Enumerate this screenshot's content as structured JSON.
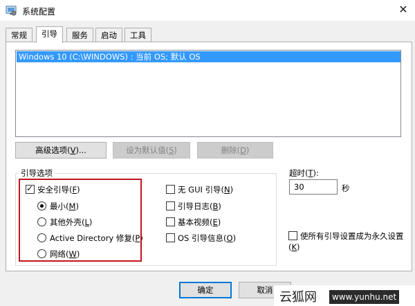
{
  "window": {
    "title": "系统配置"
  },
  "tabs": [
    {
      "label": "常规"
    },
    {
      "label": "引导",
      "active": true
    },
    {
      "label": "服务"
    },
    {
      "label": "启动"
    },
    {
      "label": "工具"
    }
  ],
  "os_list": {
    "items": [
      "Windows 10 (C:\\WINDOWS) : 当前 OS; 默认 OS"
    ]
  },
  "os_buttons": {
    "advanced": "高级选项(V)...",
    "set_default": "设为默认值(S)",
    "delete": "删除(D)"
  },
  "boot_options": {
    "legend": "引导选项",
    "safe_boot": {
      "label": "安全引导(F)",
      "checked": true
    },
    "radios": [
      {
        "label": "最小(M)",
        "checked": true
      },
      {
        "label": "其他外壳(L)",
        "checked": false
      },
      {
        "label": "Active Directory 修复(P)",
        "checked": false
      },
      {
        "label": "网络(W)",
        "checked": false
      }
    ],
    "checkboxes": [
      {
        "label": "无 GUI 引导(N)",
        "checked": false
      },
      {
        "label": "引导日志(B)",
        "checked": false
      },
      {
        "label": "基本视频(E)",
        "checked": false
      },
      {
        "label": "OS 引导信息(O)",
        "checked": false
      }
    ]
  },
  "timeout": {
    "label": "超时(T):",
    "value": "30",
    "unit": "秒"
  },
  "permanent": {
    "label": "使所有引导设置成为永久设置(K)",
    "checked": false
  },
  "footer": {
    "ok": "确定",
    "cancel": "取消"
  },
  "watermark": {
    "text": "云狐网",
    "url": "www.yunhu.net"
  },
  "colors": {
    "selection": "#3399ff",
    "highlight_box": "#c0141e",
    "accent_border": "#0078d7"
  }
}
